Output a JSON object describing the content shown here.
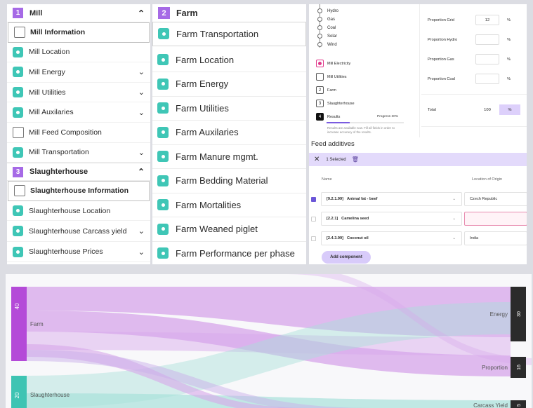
{
  "mill_panel": {
    "mill": {
      "number": "1",
      "title": "Mill",
      "items": [
        {
          "label": "Mill Information",
          "state": "selected",
          "expand": false
        },
        {
          "label": "Mill Location",
          "state": "done",
          "expand": false
        },
        {
          "label": "Mill Energy",
          "state": "done",
          "expand": true
        },
        {
          "label": "Mill Utilities",
          "state": "done",
          "expand": true
        },
        {
          "label": "Mill Auxilaries",
          "state": "done",
          "expand": true
        },
        {
          "label": "Mill Feed Composition",
          "state": "empty",
          "expand": false
        },
        {
          "label": "Mill Transportation",
          "state": "done",
          "expand": true
        }
      ]
    },
    "slaughterhouse": {
      "number": "3",
      "title": "Slaughterhouse",
      "items": [
        {
          "label": "Slaughterhouse Information",
          "state": "selected",
          "expand": false
        },
        {
          "label": "Slaughterhouse Location",
          "state": "done",
          "expand": false
        },
        {
          "label": "Slaughterhouse Carcass yield",
          "state": "done",
          "expand": true
        },
        {
          "label": "Slaughterhouse Prices",
          "state": "done",
          "expand": true
        }
      ]
    }
  },
  "farm_panel": {
    "number": "2",
    "title": "Farm",
    "items": [
      "Farm Transportation",
      "Farm Location",
      "Farm Energy",
      "Farm Utilities",
      "Farm Auxilaries",
      "Farm Manure mgmt.",
      "Farm Bedding Material",
      "Farm Mortalities",
      "Farm Weaned piglet",
      "Farm Performance per phase"
    ]
  },
  "energy_panel": {
    "sources": [
      "Hydro",
      "Gas",
      "Coal",
      "Solar",
      "Wind"
    ],
    "steps": [
      {
        "mark": "",
        "label": "Mill Electricity",
        "style": "pink"
      },
      {
        "mark": "",
        "label": "Mill Utilities",
        "style": "plain"
      },
      {
        "mark": "2",
        "label": "Farm",
        "style": "plain"
      },
      {
        "mark": "3",
        "label": "Slaughterhouse",
        "style": "plain"
      },
      {
        "mark": "4",
        "label": "Results",
        "style": "dark"
      }
    ],
    "progress_text": "Progress 30%",
    "progress": 0.3,
    "results_note": "Results are available now. Fill all fields in order to increase accuracy of the results.",
    "proportions": [
      {
        "label": "Proportion Grid",
        "value": "12",
        "unit": "%"
      },
      {
        "label": "Proportion Hydro",
        "value": "",
        "unit": "%"
      },
      {
        "label": "Proportion Gas",
        "value": "",
        "unit": "%"
      },
      {
        "label": "Proportion Coal",
        "value": "",
        "unit": "%"
      }
    ],
    "total": {
      "label": "Total",
      "value": "100",
      "unit": "%"
    }
  },
  "feed_additives": {
    "title": "Feed additives",
    "selected_text": "1 Selected",
    "col_name": "Name",
    "col_origin": "Location of Origin",
    "rows": [
      {
        "checked": true,
        "code": "[9.2.1.99]",
        "name": "Animal fat - beef",
        "origin": "Czech Republic",
        "error": false
      },
      {
        "checked": false,
        "code": "[2.2.1]",
        "name": "Camelina seed",
        "origin": "",
        "error": true
      },
      {
        "checked": false,
        "code": "[2.4.3.99]",
        "name": "Coconut oil",
        "origin": "India",
        "error": false
      }
    ],
    "add_button": "Add component"
  },
  "sankey": {
    "colors": {
      "farm": "#b44ad8",
      "slaughterhouse": "#3ec4b3",
      "target": "#2b2b2b",
      "farm_flow": "#d7a6ea",
      "slaughter_flow": "#a8e1da"
    },
    "sources": [
      {
        "label": "Farm",
        "value": "40"
      },
      {
        "label": "Slaughterhouse",
        "value": "20"
      }
    ],
    "targets": [
      {
        "label": "Energy",
        "value": "30"
      },
      {
        "label": "Proportion",
        "value": "16"
      },
      {
        "label": "Carcass Yield",
        "value": "5"
      }
    ]
  }
}
